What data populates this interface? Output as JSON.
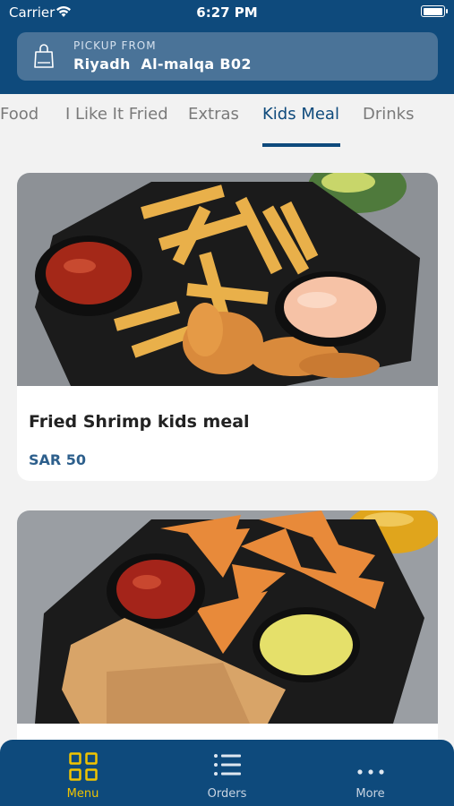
{
  "status_bar": {
    "carrier": "Carrier",
    "time": "6:27 PM",
    "battery_level": 0.95
  },
  "pickup": {
    "label": "PICKUP FROM",
    "location": "Riyadh  Al-malqa B02"
  },
  "tabs": [
    {
      "label": "Food",
      "active": false
    },
    {
      "label": "I Like It Fried",
      "active": false
    },
    {
      "label": "Extras",
      "active": false
    },
    {
      "label": "Kids Meal",
      "active": true
    },
    {
      "label": "Drinks",
      "active": false
    }
  ],
  "products": [
    {
      "name": "Fried Shrimp kids meal",
      "price": "SAR 50"
    },
    {
      "name": "",
      "price": ""
    }
  ],
  "bottom_nav": [
    {
      "label": "Menu",
      "icon": "grid-icon",
      "active": true
    },
    {
      "label": "Orders",
      "icon": "list-icon",
      "active": false
    },
    {
      "label": "More",
      "icon": "dots-icon",
      "active": false
    }
  ],
  "colors": {
    "brand": "#0e4a7c",
    "accent": "#f0c400",
    "price": "#2d5f8c"
  }
}
